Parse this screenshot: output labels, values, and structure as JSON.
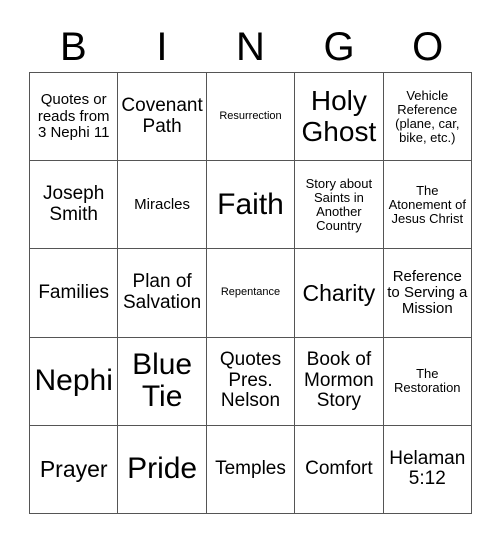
{
  "card": {
    "header_letters": [
      "B",
      "I",
      "N",
      "G",
      "O"
    ],
    "rows": [
      [
        "Quotes or reads from 3 Nephi 11",
        "Covenant Path",
        "Resurrection",
        "Holy Ghost",
        "Vehicle Reference (plane, car, bike, etc.)"
      ],
      [
        "Joseph Smith",
        "Miracles",
        "Faith",
        "Story about Saints in Another Country",
        "The Atonement of Jesus Christ"
      ],
      [
        "Families",
        "Plan of Salvation",
        "Repentance",
        "Charity",
        "Reference to Serving a Mission"
      ],
      [
        "Nephi",
        "Blue Tie",
        "Quotes Pres. Nelson",
        "Book of Mormon Story",
        "The Restoration"
      ],
      [
        "Prayer",
        "Pride",
        "Temples",
        "Comfort",
        "Helaman 5:12"
      ]
    ],
    "colors": {
      "background": "#ffffff",
      "text": "#000000",
      "border": "#555555"
    }
  }
}
